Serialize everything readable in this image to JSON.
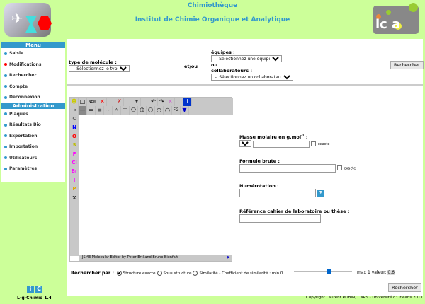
{
  "header": {
    "title": "Chimiothèque",
    "subtitle": "Institut de Chimie Organique et Analytique",
    "logo_right_text": "ICOA"
  },
  "sidebar": {
    "menu_title": "Menu",
    "menu_items": [
      {
        "label": "Saisie",
        "active": false
      },
      {
        "label": "Modifications",
        "active": true
      },
      {
        "label": "Rechercher",
        "active": false
      },
      {
        "label": "Compte",
        "active": false
      },
      {
        "label": "Déconnexion",
        "active": false
      }
    ],
    "admin_title": "Administration",
    "admin_items": [
      {
        "label": "Plaques"
      },
      {
        "label": "Résultats Bio"
      },
      {
        "label": "Exportation"
      },
      {
        "label": "Importation"
      },
      {
        "label": "Utilisateurs"
      },
      {
        "label": "Paramètres"
      }
    ],
    "footer_logo": "iC",
    "version_label": "L-g-Chimio 1.4"
  },
  "filters": {
    "type_label": "type de molécule :",
    "type_value": "-- Sélectionnez le type --",
    "andor": "et/ou",
    "equipes_label": "équipes :",
    "equipes_value": "-- Sélectionnez une équipe --",
    "ou": "ou",
    "collab_label": "collaborateurs :",
    "collab_value": "-- Sélectionnez un collaborateur --",
    "search_button": "Rechercher"
  },
  "editor": {
    "new_label": "NEW",
    "fg_label": "FG",
    "atoms": [
      "C",
      "N",
      "O",
      "S",
      "F",
      "Cl",
      "Br",
      "I",
      "P",
      "X"
    ],
    "atom_colors": [
      "#666666",
      "#0000ff",
      "#ff0000",
      "#bbbb00",
      "#ff00ff",
      "#ff00ff",
      "#ff00ff",
      "#ff00ff",
      "#ddaa00",
      "#333333"
    ],
    "footer": "JSME Molecular Editor by Peter Ertl and Bruno Bienfait"
  },
  "fields": {
    "masse_label": "Masse molaire en g.mol",
    "masse_sup": "-1",
    "masse_colon": " :",
    "masse_op": "=",
    "masse_value": "",
    "exacte": "exacte",
    "formule_label": "Formule brute :",
    "formule_value": "",
    "numerotation_label": "Numérotation :",
    "numerotation_value": "",
    "help": "?",
    "reference_label": "Référence cahier de laboratoire ou thèse :",
    "reference_value": ""
  },
  "search_by": {
    "label": "Rechercher par :",
    "options": [
      {
        "label": "Structure exacte",
        "checked": true
      },
      {
        "label": "Sous structure",
        "checked": false
      },
      {
        "label": "Similarité",
        "checked": false
      }
    ],
    "coef_label": "- Coefficient de similarité : min 0",
    "max_label": "max 1 valeur:",
    "value": "0.6",
    "slider_value": 0.6
  },
  "bottom_button": "Rechercher",
  "copyright": "Copyright Laurent ROBIN, CNRS - Université d'Orléans 2011"
}
